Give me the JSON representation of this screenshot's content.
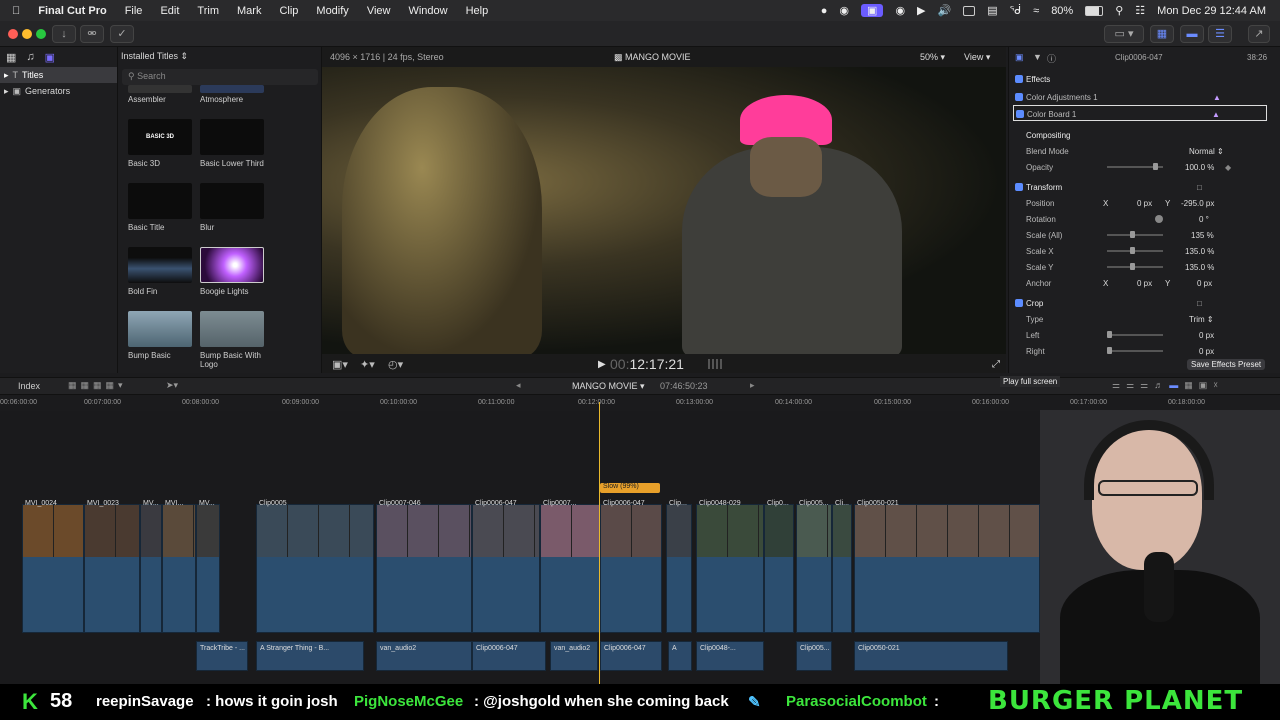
{
  "menubar": {
    "app": "Final Cut Pro",
    "items": [
      "File",
      "Edit",
      "Trim",
      "Mark",
      "Clip",
      "Modify",
      "View",
      "Window",
      "Help"
    ],
    "battery": "80%",
    "datetime": "Mon Dec 29  12:44 AM"
  },
  "sidebar": {
    "items": [
      {
        "label": "Titles",
        "selected": true
      },
      {
        "label": "Generators",
        "selected": false
      }
    ]
  },
  "browser": {
    "header": "Installed Titles",
    "search_placeholder": "Search",
    "titles": [
      "Assembler",
      "Atmosphere",
      "Basic 3D",
      "Basic Lower Third",
      "Basic Title",
      "Blur",
      "Bold Fin",
      "Boogie Lights",
      "Bump Basic",
      "Bump Basic With Logo"
    ]
  },
  "viewer": {
    "format": "4096 × 1716 | 24 fps, Stereo",
    "project": "MANGO MOVIE",
    "zoom": "50%",
    "view": "View",
    "timecode": "12:17:21",
    "timecode_prefix": "00:",
    "fullscreen_tooltip": "Play full screen"
  },
  "inspector": {
    "clip": "Clip0006-047",
    "duration": "38:26",
    "effects_header": "Effects",
    "effect1": "Color Adjustments 1",
    "effect2": "Color Board 1",
    "compositing": "Compositing",
    "blend_label": "Blend Mode",
    "blend_value": "Normal",
    "opacity_label": "Opacity",
    "opacity_value": "100.0 %",
    "transform": "Transform",
    "position_label": "Position",
    "pos_x_label": "X",
    "pos_x": "0 px",
    "pos_y_label": "Y",
    "pos_y": "-295.0 px",
    "rotation_label": "Rotation",
    "rotation_value": "0 °",
    "scale_all_label": "Scale (All)",
    "scale_all": "135 %",
    "scale_x_label": "Scale X",
    "scale_x": "135.0 %",
    "scale_y_label": "Scale Y",
    "scale_y": "135.0 %",
    "anchor_label": "Anchor",
    "anchor_x_label": "X",
    "anchor_x": "0 px",
    "anchor_y_label": "Y",
    "anchor_y": "0 px",
    "crop": "Crop",
    "type_label": "Type",
    "type_value": "Trim",
    "left_label": "Left",
    "left_value": "0 px",
    "right_label": "Right",
    "right_value": "0 px",
    "save_preset": "Save Effects Preset",
    "opacity_level": 0.85,
    "scale_level": 0.45
  },
  "timeline": {
    "index": "Index",
    "project": "MANGO MOVIE",
    "duration": "07:46:50:23",
    "ruler": [
      "00:06:00:00",
      "00:07:00:00",
      "00:08:00:00",
      "00:09:00:00",
      "00:10:00:00",
      "00:11:00:00",
      "00:12:00:00",
      "00:13:00:00",
      "00:14:00:00",
      "00:15:00:00",
      "00:16:00:00",
      "00:17:00:00",
      "00:18:00:00"
    ],
    "retime": "Slow (99%)",
    "clips": [
      "MVI_0024",
      "MVI_0023",
      "MV...",
      "MVI...",
      "MV...",
      "Clip0005",
      "Clip0007-046",
      "Clip0006-047",
      "Clip0007...",
      "Clip0006-047",
      "Clip...",
      "Clip0048-029",
      "Clip0...",
      "Clip005...",
      "Cli...",
      "Clip0050-021"
    ],
    "audio": [
      "TrackTribe - ...",
      "A Stranger Thing - B...",
      "van_audio2",
      "Clip0006-047",
      "van_audio2",
      "Clip0006-047",
      "A",
      "Clip0048-...",
      "Clip005...",
      "Clip0050-021"
    ]
  },
  "overlay": {
    "kicks": "58",
    "chat": [
      {
        "user": "reepinSavage",
        "msg": ": hows it goin josh"
      },
      {
        "user": "PigNoseMcGee",
        "msg": ": @joshgold when she coming back"
      },
      {
        "user": "ParasocialCoombot",
        "msg": ":"
      }
    ],
    "brand": "BURGER PLANET"
  }
}
